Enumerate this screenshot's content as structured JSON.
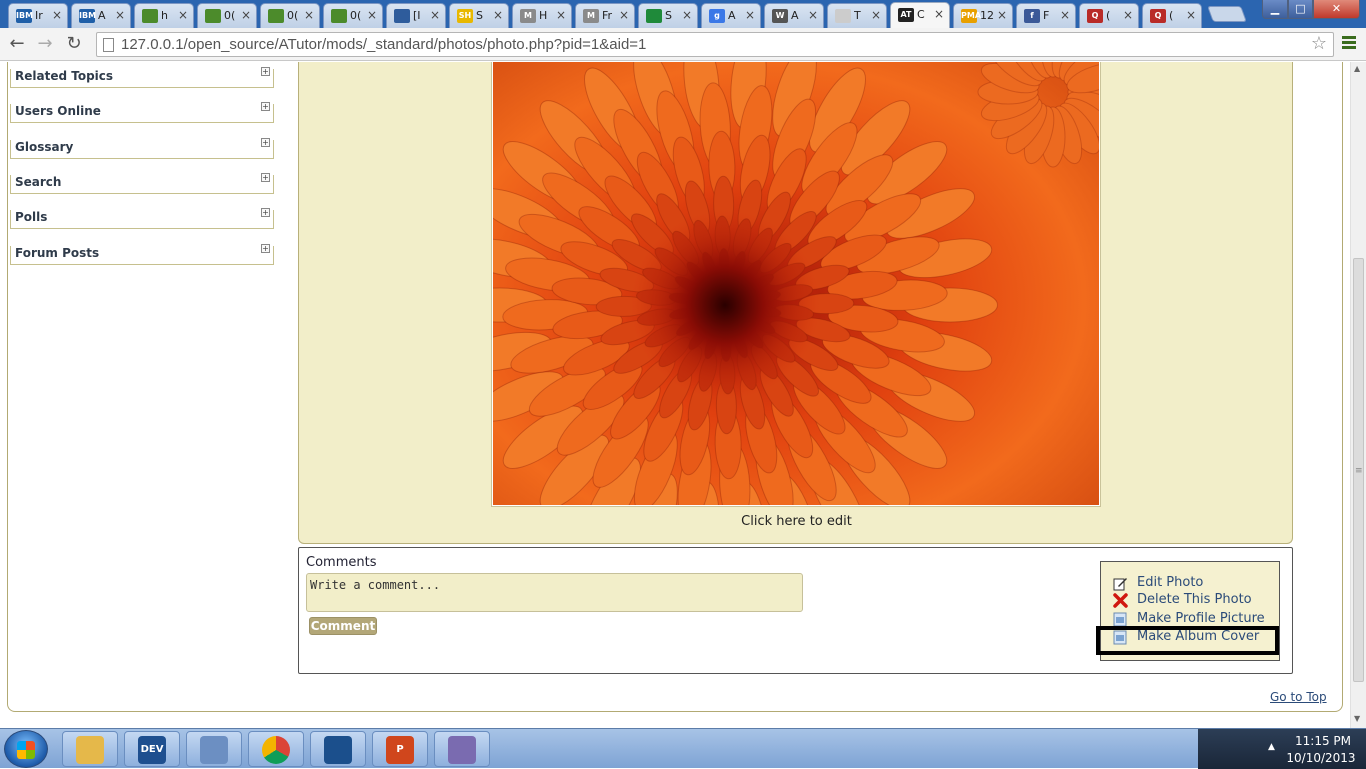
{
  "browser": {
    "tabs": [
      {
        "icon": "ibm-icon",
        "icon_text": "IBM",
        "short_title": "Ir"
      },
      {
        "icon": "ibm-icon",
        "icon_text": "IBM",
        "short_title": "A"
      },
      {
        "icon": "frog-icon",
        "icon_text": "",
        "short_title": "h"
      },
      {
        "icon": "frog-icon",
        "icon_text": "",
        "short_title": "0("
      },
      {
        "icon": "frog-icon",
        "icon_text": "",
        "short_title": "0("
      },
      {
        "icon": "frog-icon",
        "icon_text": "",
        "short_title": "0("
      },
      {
        "icon": "puzzle-icon",
        "icon_text": "",
        "short_title": "[I"
      },
      {
        "icon": "sh-icon",
        "icon_text": "SH",
        "short_title": "S"
      },
      {
        "icon": "moodle-icon",
        "icon_text": "M",
        "short_title": "H"
      },
      {
        "icon": "moodle-icon",
        "icon_text": "M",
        "short_title": "Fr"
      },
      {
        "icon": "sheet-icon",
        "icon_text": "",
        "short_title": "S"
      },
      {
        "icon": "google-icon",
        "icon_text": "g",
        "short_title": "A"
      },
      {
        "icon": "wikipedia-icon",
        "icon_text": "W",
        "short_title": "A"
      },
      {
        "icon": "page-icon",
        "icon_text": "",
        "short_title": "T"
      },
      {
        "icon": "atutor-icon",
        "icon_text": "AT",
        "short_title": "C"
      },
      {
        "icon": "pma-icon",
        "icon_text": "PMA",
        "short_title": "12"
      },
      {
        "icon": "facebook-icon",
        "icon_text": "f",
        "short_title": "F"
      },
      {
        "icon": "quora-icon",
        "icon_text": "Q",
        "short_title": "("
      },
      {
        "icon": "quora-icon",
        "icon_text": "Q",
        "short_title": "("
      }
    ],
    "tab_close_glyph": "×",
    "active_tab_index": 14,
    "url": "127.0.0.1/open_source/ATutor/mods/_standard/photos/photo.php?pid=1&aid=1",
    "back_glyph": "←",
    "forward_glyph": "→",
    "reload_glyph": "↻",
    "star_glyph": "☆",
    "min_glyph": "▁",
    "max_glyph": "□",
    "close_glyph": "✕"
  },
  "sidebar": {
    "items": [
      {
        "label": "Related Topics"
      },
      {
        "label": "Users Online"
      },
      {
        "label": "Glossary"
      },
      {
        "label": "Search"
      },
      {
        "label": "Polls"
      },
      {
        "label": "Forum Posts"
      }
    ],
    "expand_glyph": "+"
  },
  "photo": {
    "edit_caption": "Click here to edit"
  },
  "comments": {
    "label": "Comments",
    "placeholder": "Write a comment...",
    "submit_label": "Comment"
  },
  "actions": {
    "edit": "Edit Photo",
    "delete": "Delete This Photo",
    "profile": "Make Profile Picture",
    "album_cover": "Make Album Cover"
  },
  "footer": {
    "go_top": "Go to Top"
  },
  "taskbar": {
    "apps": [
      {
        "name": "explorer-icon",
        "text": ""
      },
      {
        "name": "dev-icon",
        "text": "DEV"
      },
      {
        "name": "virtualbox-icon",
        "text": ""
      },
      {
        "name": "chrome-icon",
        "text": ""
      },
      {
        "name": "app-c-icon",
        "text": ""
      },
      {
        "name": "powerpoint-icon",
        "text": "P"
      },
      {
        "name": "pidgin-icon",
        "text": ""
      }
    ],
    "time": "11:15 PM",
    "date": "10/10/2013",
    "tray_glyph": "▲"
  },
  "colors": {
    "panel_bg": "#f2eec9",
    "link": "#2b4b79",
    "button_bg": "#b3a778",
    "highlight": "#000000"
  }
}
